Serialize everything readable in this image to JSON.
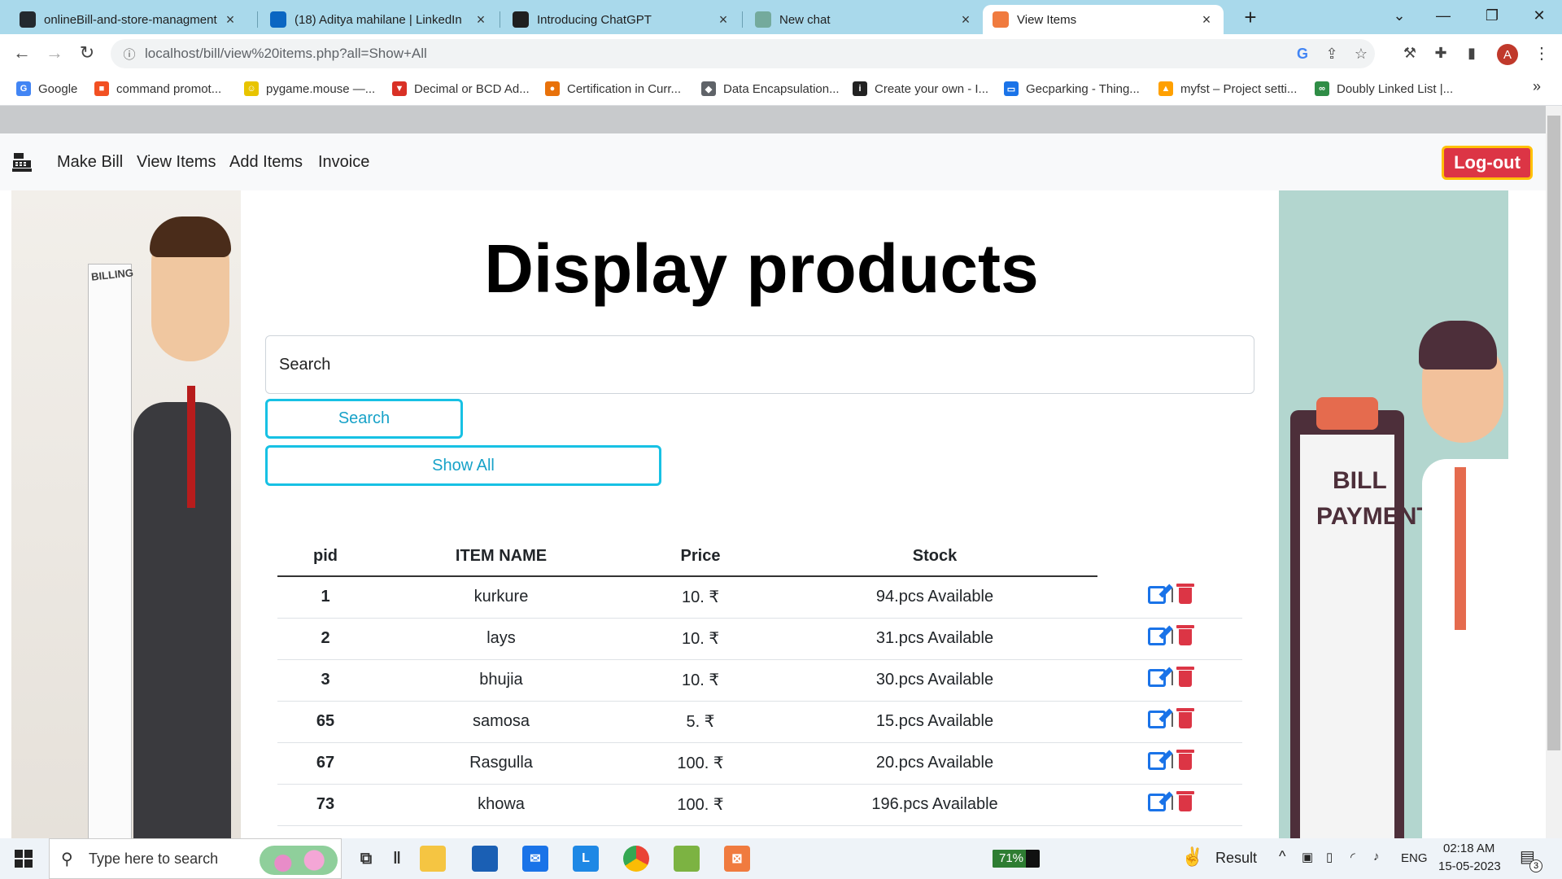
{
  "browser": {
    "tabs": [
      {
        "title": "onlineBill-and-store-managment",
        "favicon": "github-icon",
        "color": "#24292e",
        "active": false
      },
      {
        "title": "(18) Aditya mahilane | LinkedIn",
        "favicon": "linkedin-icon",
        "color": "#0a66c2",
        "active": false
      },
      {
        "title": "Introducing ChatGPT",
        "favicon": "openai-icon",
        "color": "#1f1f1f",
        "active": false
      },
      {
        "title": "New chat",
        "favicon": "chatgpt-icon",
        "color": "#74aa9c",
        "active": false
      },
      {
        "title": "View Items",
        "favicon": "xampp-icon",
        "color": "#f07b3f",
        "active": true
      }
    ],
    "new_tab": "+",
    "url": "localhost/bill/view%20items.php?all=Show+All",
    "profile_initial": "A",
    "bookmarks": [
      {
        "label": "Google",
        "icon": "google-icon",
        "color": "#4285f4",
        "glyph": "G"
      },
      {
        "label": "command promot...",
        "icon": "microsoft-icon",
        "color": "#f25022",
        "glyph": "■"
      },
      {
        "label": "pygame.mouse —...",
        "icon": "pygame-icon",
        "color": "#e8c400",
        "glyph": "☺"
      },
      {
        "label": "Decimal or BCD Ad...",
        "icon": "tutorial-icon",
        "color": "#d93025",
        "glyph": "▼"
      },
      {
        "label": "Certification in Curr...",
        "icon": "cert-icon",
        "color": "#e8710a",
        "glyph": "●"
      },
      {
        "label": "Data Encapsulation...",
        "icon": "diamond-icon",
        "color": "#5f6368",
        "glyph": "◆"
      },
      {
        "label": "Create your own - I...",
        "icon": "ifttt-icon",
        "color": "#222222",
        "glyph": "i"
      },
      {
        "label": "Gecparking - Thing...",
        "icon": "chat-icon",
        "color": "#1a73e8",
        "glyph": "▭"
      },
      {
        "label": "myfst – Project setti...",
        "icon": "firebase-icon",
        "color": "#ffa000",
        "glyph": "▲"
      },
      {
        "label": "Doubly Linked List |...",
        "icon": "gfg-icon",
        "color": "#2f8d46",
        "glyph": "∞"
      }
    ]
  },
  "nav": {
    "brand_icon": "cash-register-icon",
    "links": [
      "Make Bill",
      "View Items",
      "Add Items",
      "Invoice"
    ],
    "logout": "Log-out"
  },
  "left_image": {
    "label": "BILLING"
  },
  "right_image": {
    "line1": "BILL",
    "line2": "PAYMENT"
  },
  "main": {
    "heading": "Display products",
    "search_placeholder": "Search",
    "search_button": "Search",
    "show_all_button": "Show All"
  },
  "table": {
    "headers": [
      "pid",
      "ITEM NAME",
      "Price",
      "Stock"
    ],
    "rows": [
      {
        "pid": "1",
        "name": "kurkure",
        "price": "10. ₹",
        "stock": "94.pcs Available"
      },
      {
        "pid": "2",
        "name": "lays",
        "price": "10. ₹",
        "stock": "31.pcs Available"
      },
      {
        "pid": "3",
        "name": "bhujia",
        "price": "10. ₹",
        "stock": "30.pcs Available"
      },
      {
        "pid": "65",
        "name": "samosa",
        "price": "5. ₹",
        "stock": "15.pcs Available"
      },
      {
        "pid": "67",
        "name": "Rasgulla",
        "price": "100. ₹",
        "stock": "20.pcs Available"
      },
      {
        "pid": "73",
        "name": "khowa",
        "price": "100. ₹",
        "stock": "196.pcs Available"
      }
    ],
    "separator": "|"
  },
  "taskbar": {
    "search_placeholder": "Type here to search",
    "battery": "71%",
    "result_label": "Result",
    "language": "ENG",
    "time": "02:18 AM",
    "date": "15-05-2023",
    "notification_count": "3"
  },
  "colors": {
    "logout_bg": "#dc3545",
    "logout_border": "#ffc107",
    "outline_button": "#17c1e4",
    "edit_icon": "#1a73e8",
    "delete_icon": "#dc3545"
  }
}
